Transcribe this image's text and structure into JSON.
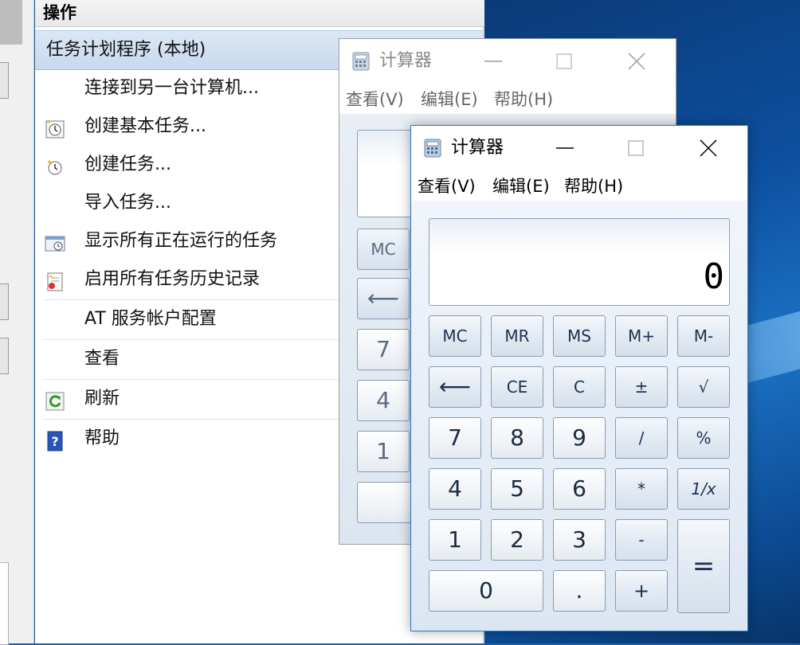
{
  "actions_pane": {
    "header": "操作",
    "section_title": "任务计划程序 (本地)",
    "items": [
      {
        "label": "连接到另一台计算机...",
        "icon": "none"
      },
      {
        "label": "创建基本任务...",
        "icon": "create-basic-task-icon"
      },
      {
        "label": "创建任务...",
        "icon": "create-task-icon"
      },
      {
        "label": "导入任务...",
        "icon": "none"
      },
      {
        "label": "显示所有正在运行的任务",
        "icon": "running-tasks-icon"
      },
      {
        "label": "启用所有任务历史记录",
        "icon": "task-history-icon"
      },
      {
        "label": "AT 服务帐户配置",
        "icon": "none"
      },
      {
        "label": "查看",
        "icon": "none"
      },
      {
        "label": "刷新",
        "icon": "refresh-icon"
      },
      {
        "label": "帮助",
        "icon": "help-icon"
      }
    ]
  },
  "calculator_back": {
    "title": "计算器",
    "menu": [
      "查看(V)",
      "编辑(E)",
      "帮助(H)"
    ],
    "visible_keys": [
      "MC",
      "⟵",
      "7",
      "4",
      "1"
    ]
  },
  "calculator_front": {
    "title": "计算器",
    "menu": [
      "查看(V)",
      "编辑(E)",
      "帮助(H)"
    ],
    "display_value": "0",
    "keys": {
      "row1": [
        "MC",
        "MR",
        "MS",
        "M+",
        "M-"
      ],
      "row2": [
        "⟵",
        "CE",
        "C",
        "±",
        "√"
      ],
      "row3": [
        "7",
        "8",
        "9",
        "/",
        "%"
      ],
      "row4": [
        "4",
        "5",
        "6",
        "*",
        "1/x"
      ],
      "row5": [
        "1",
        "2",
        "3",
        "-",
        "="
      ],
      "row6": [
        "0",
        "."
      ],
      "plus": "+"
    }
  },
  "colors": {
    "section_highlight": "#c8d9ee",
    "front_window_border": "#2b78c8",
    "desktop": "#0d4f9e"
  }
}
